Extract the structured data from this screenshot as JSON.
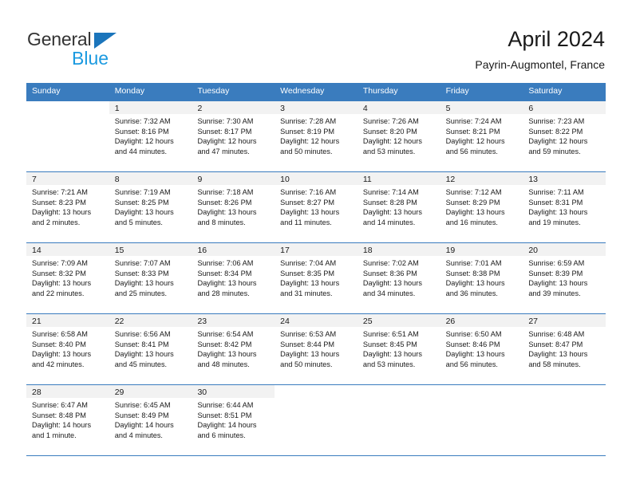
{
  "brand": {
    "name_part1": "General",
    "name_part2": "Blue",
    "triangle_color": "#1b75bb",
    "part2_color": "#1b9ae0"
  },
  "header": {
    "title": "April 2024",
    "subtitle": "Payrin-Augmontel, France"
  },
  "calendar": {
    "header_bg": "#3a7cbe",
    "header_text_color": "#ffffff",
    "daynum_bg": "#f2f2f2",
    "weekdays": [
      "Sunday",
      "Monday",
      "Tuesday",
      "Wednesday",
      "Thursday",
      "Friday",
      "Saturday"
    ],
    "weeks": [
      [
        {
          "day": "",
          "sunrise": "",
          "sunset": "",
          "daylight1": "",
          "daylight2": ""
        },
        {
          "day": "1",
          "sunrise": "Sunrise: 7:32 AM",
          "sunset": "Sunset: 8:16 PM",
          "daylight1": "Daylight: 12 hours",
          "daylight2": "and 44 minutes."
        },
        {
          "day": "2",
          "sunrise": "Sunrise: 7:30 AM",
          "sunset": "Sunset: 8:17 PM",
          "daylight1": "Daylight: 12 hours",
          "daylight2": "and 47 minutes."
        },
        {
          "day": "3",
          "sunrise": "Sunrise: 7:28 AM",
          "sunset": "Sunset: 8:19 PM",
          "daylight1": "Daylight: 12 hours",
          "daylight2": "and 50 minutes."
        },
        {
          "day": "4",
          "sunrise": "Sunrise: 7:26 AM",
          "sunset": "Sunset: 8:20 PM",
          "daylight1": "Daylight: 12 hours",
          "daylight2": "and 53 minutes."
        },
        {
          "day": "5",
          "sunrise": "Sunrise: 7:24 AM",
          "sunset": "Sunset: 8:21 PM",
          "daylight1": "Daylight: 12 hours",
          "daylight2": "and 56 minutes."
        },
        {
          "day": "6",
          "sunrise": "Sunrise: 7:23 AM",
          "sunset": "Sunset: 8:22 PM",
          "daylight1": "Daylight: 12 hours",
          "daylight2": "and 59 minutes."
        }
      ],
      [
        {
          "day": "7",
          "sunrise": "Sunrise: 7:21 AM",
          "sunset": "Sunset: 8:23 PM",
          "daylight1": "Daylight: 13 hours",
          "daylight2": "and 2 minutes."
        },
        {
          "day": "8",
          "sunrise": "Sunrise: 7:19 AM",
          "sunset": "Sunset: 8:25 PM",
          "daylight1": "Daylight: 13 hours",
          "daylight2": "and 5 minutes."
        },
        {
          "day": "9",
          "sunrise": "Sunrise: 7:18 AM",
          "sunset": "Sunset: 8:26 PM",
          "daylight1": "Daylight: 13 hours",
          "daylight2": "and 8 minutes."
        },
        {
          "day": "10",
          "sunrise": "Sunrise: 7:16 AM",
          "sunset": "Sunset: 8:27 PM",
          "daylight1": "Daylight: 13 hours",
          "daylight2": "and 11 minutes."
        },
        {
          "day": "11",
          "sunrise": "Sunrise: 7:14 AM",
          "sunset": "Sunset: 8:28 PM",
          "daylight1": "Daylight: 13 hours",
          "daylight2": "and 14 minutes."
        },
        {
          "day": "12",
          "sunrise": "Sunrise: 7:12 AM",
          "sunset": "Sunset: 8:29 PM",
          "daylight1": "Daylight: 13 hours",
          "daylight2": "and 16 minutes."
        },
        {
          "day": "13",
          "sunrise": "Sunrise: 7:11 AM",
          "sunset": "Sunset: 8:31 PM",
          "daylight1": "Daylight: 13 hours",
          "daylight2": "and 19 minutes."
        }
      ],
      [
        {
          "day": "14",
          "sunrise": "Sunrise: 7:09 AM",
          "sunset": "Sunset: 8:32 PM",
          "daylight1": "Daylight: 13 hours",
          "daylight2": "and 22 minutes."
        },
        {
          "day": "15",
          "sunrise": "Sunrise: 7:07 AM",
          "sunset": "Sunset: 8:33 PM",
          "daylight1": "Daylight: 13 hours",
          "daylight2": "and 25 minutes."
        },
        {
          "day": "16",
          "sunrise": "Sunrise: 7:06 AM",
          "sunset": "Sunset: 8:34 PM",
          "daylight1": "Daylight: 13 hours",
          "daylight2": "and 28 minutes."
        },
        {
          "day": "17",
          "sunrise": "Sunrise: 7:04 AM",
          "sunset": "Sunset: 8:35 PM",
          "daylight1": "Daylight: 13 hours",
          "daylight2": "and 31 minutes."
        },
        {
          "day": "18",
          "sunrise": "Sunrise: 7:02 AM",
          "sunset": "Sunset: 8:36 PM",
          "daylight1": "Daylight: 13 hours",
          "daylight2": "and 34 minutes."
        },
        {
          "day": "19",
          "sunrise": "Sunrise: 7:01 AM",
          "sunset": "Sunset: 8:38 PM",
          "daylight1": "Daylight: 13 hours",
          "daylight2": "and 36 minutes."
        },
        {
          "day": "20",
          "sunrise": "Sunrise: 6:59 AM",
          "sunset": "Sunset: 8:39 PM",
          "daylight1": "Daylight: 13 hours",
          "daylight2": "and 39 minutes."
        }
      ],
      [
        {
          "day": "21",
          "sunrise": "Sunrise: 6:58 AM",
          "sunset": "Sunset: 8:40 PM",
          "daylight1": "Daylight: 13 hours",
          "daylight2": "and 42 minutes."
        },
        {
          "day": "22",
          "sunrise": "Sunrise: 6:56 AM",
          "sunset": "Sunset: 8:41 PM",
          "daylight1": "Daylight: 13 hours",
          "daylight2": "and 45 minutes."
        },
        {
          "day": "23",
          "sunrise": "Sunrise: 6:54 AM",
          "sunset": "Sunset: 8:42 PM",
          "daylight1": "Daylight: 13 hours",
          "daylight2": "and 48 minutes."
        },
        {
          "day": "24",
          "sunrise": "Sunrise: 6:53 AM",
          "sunset": "Sunset: 8:44 PM",
          "daylight1": "Daylight: 13 hours",
          "daylight2": "and 50 minutes."
        },
        {
          "day": "25",
          "sunrise": "Sunrise: 6:51 AM",
          "sunset": "Sunset: 8:45 PM",
          "daylight1": "Daylight: 13 hours",
          "daylight2": "and 53 minutes."
        },
        {
          "day": "26",
          "sunrise": "Sunrise: 6:50 AM",
          "sunset": "Sunset: 8:46 PM",
          "daylight1": "Daylight: 13 hours",
          "daylight2": "and 56 minutes."
        },
        {
          "day": "27",
          "sunrise": "Sunrise: 6:48 AM",
          "sunset": "Sunset: 8:47 PM",
          "daylight1": "Daylight: 13 hours",
          "daylight2": "and 58 minutes."
        }
      ],
      [
        {
          "day": "28",
          "sunrise": "Sunrise: 6:47 AM",
          "sunset": "Sunset: 8:48 PM",
          "daylight1": "Daylight: 14 hours",
          "daylight2": "and 1 minute."
        },
        {
          "day": "29",
          "sunrise": "Sunrise: 6:45 AM",
          "sunset": "Sunset: 8:49 PM",
          "daylight1": "Daylight: 14 hours",
          "daylight2": "and 4 minutes."
        },
        {
          "day": "30",
          "sunrise": "Sunrise: 6:44 AM",
          "sunset": "Sunset: 8:51 PM",
          "daylight1": "Daylight: 14 hours",
          "daylight2": "and 6 minutes."
        },
        {
          "day": "",
          "sunrise": "",
          "sunset": "",
          "daylight1": "",
          "daylight2": ""
        },
        {
          "day": "",
          "sunrise": "",
          "sunset": "",
          "daylight1": "",
          "daylight2": ""
        },
        {
          "day": "",
          "sunrise": "",
          "sunset": "",
          "daylight1": "",
          "daylight2": ""
        },
        {
          "day": "",
          "sunrise": "",
          "sunset": "",
          "daylight1": "",
          "daylight2": ""
        }
      ]
    ]
  }
}
